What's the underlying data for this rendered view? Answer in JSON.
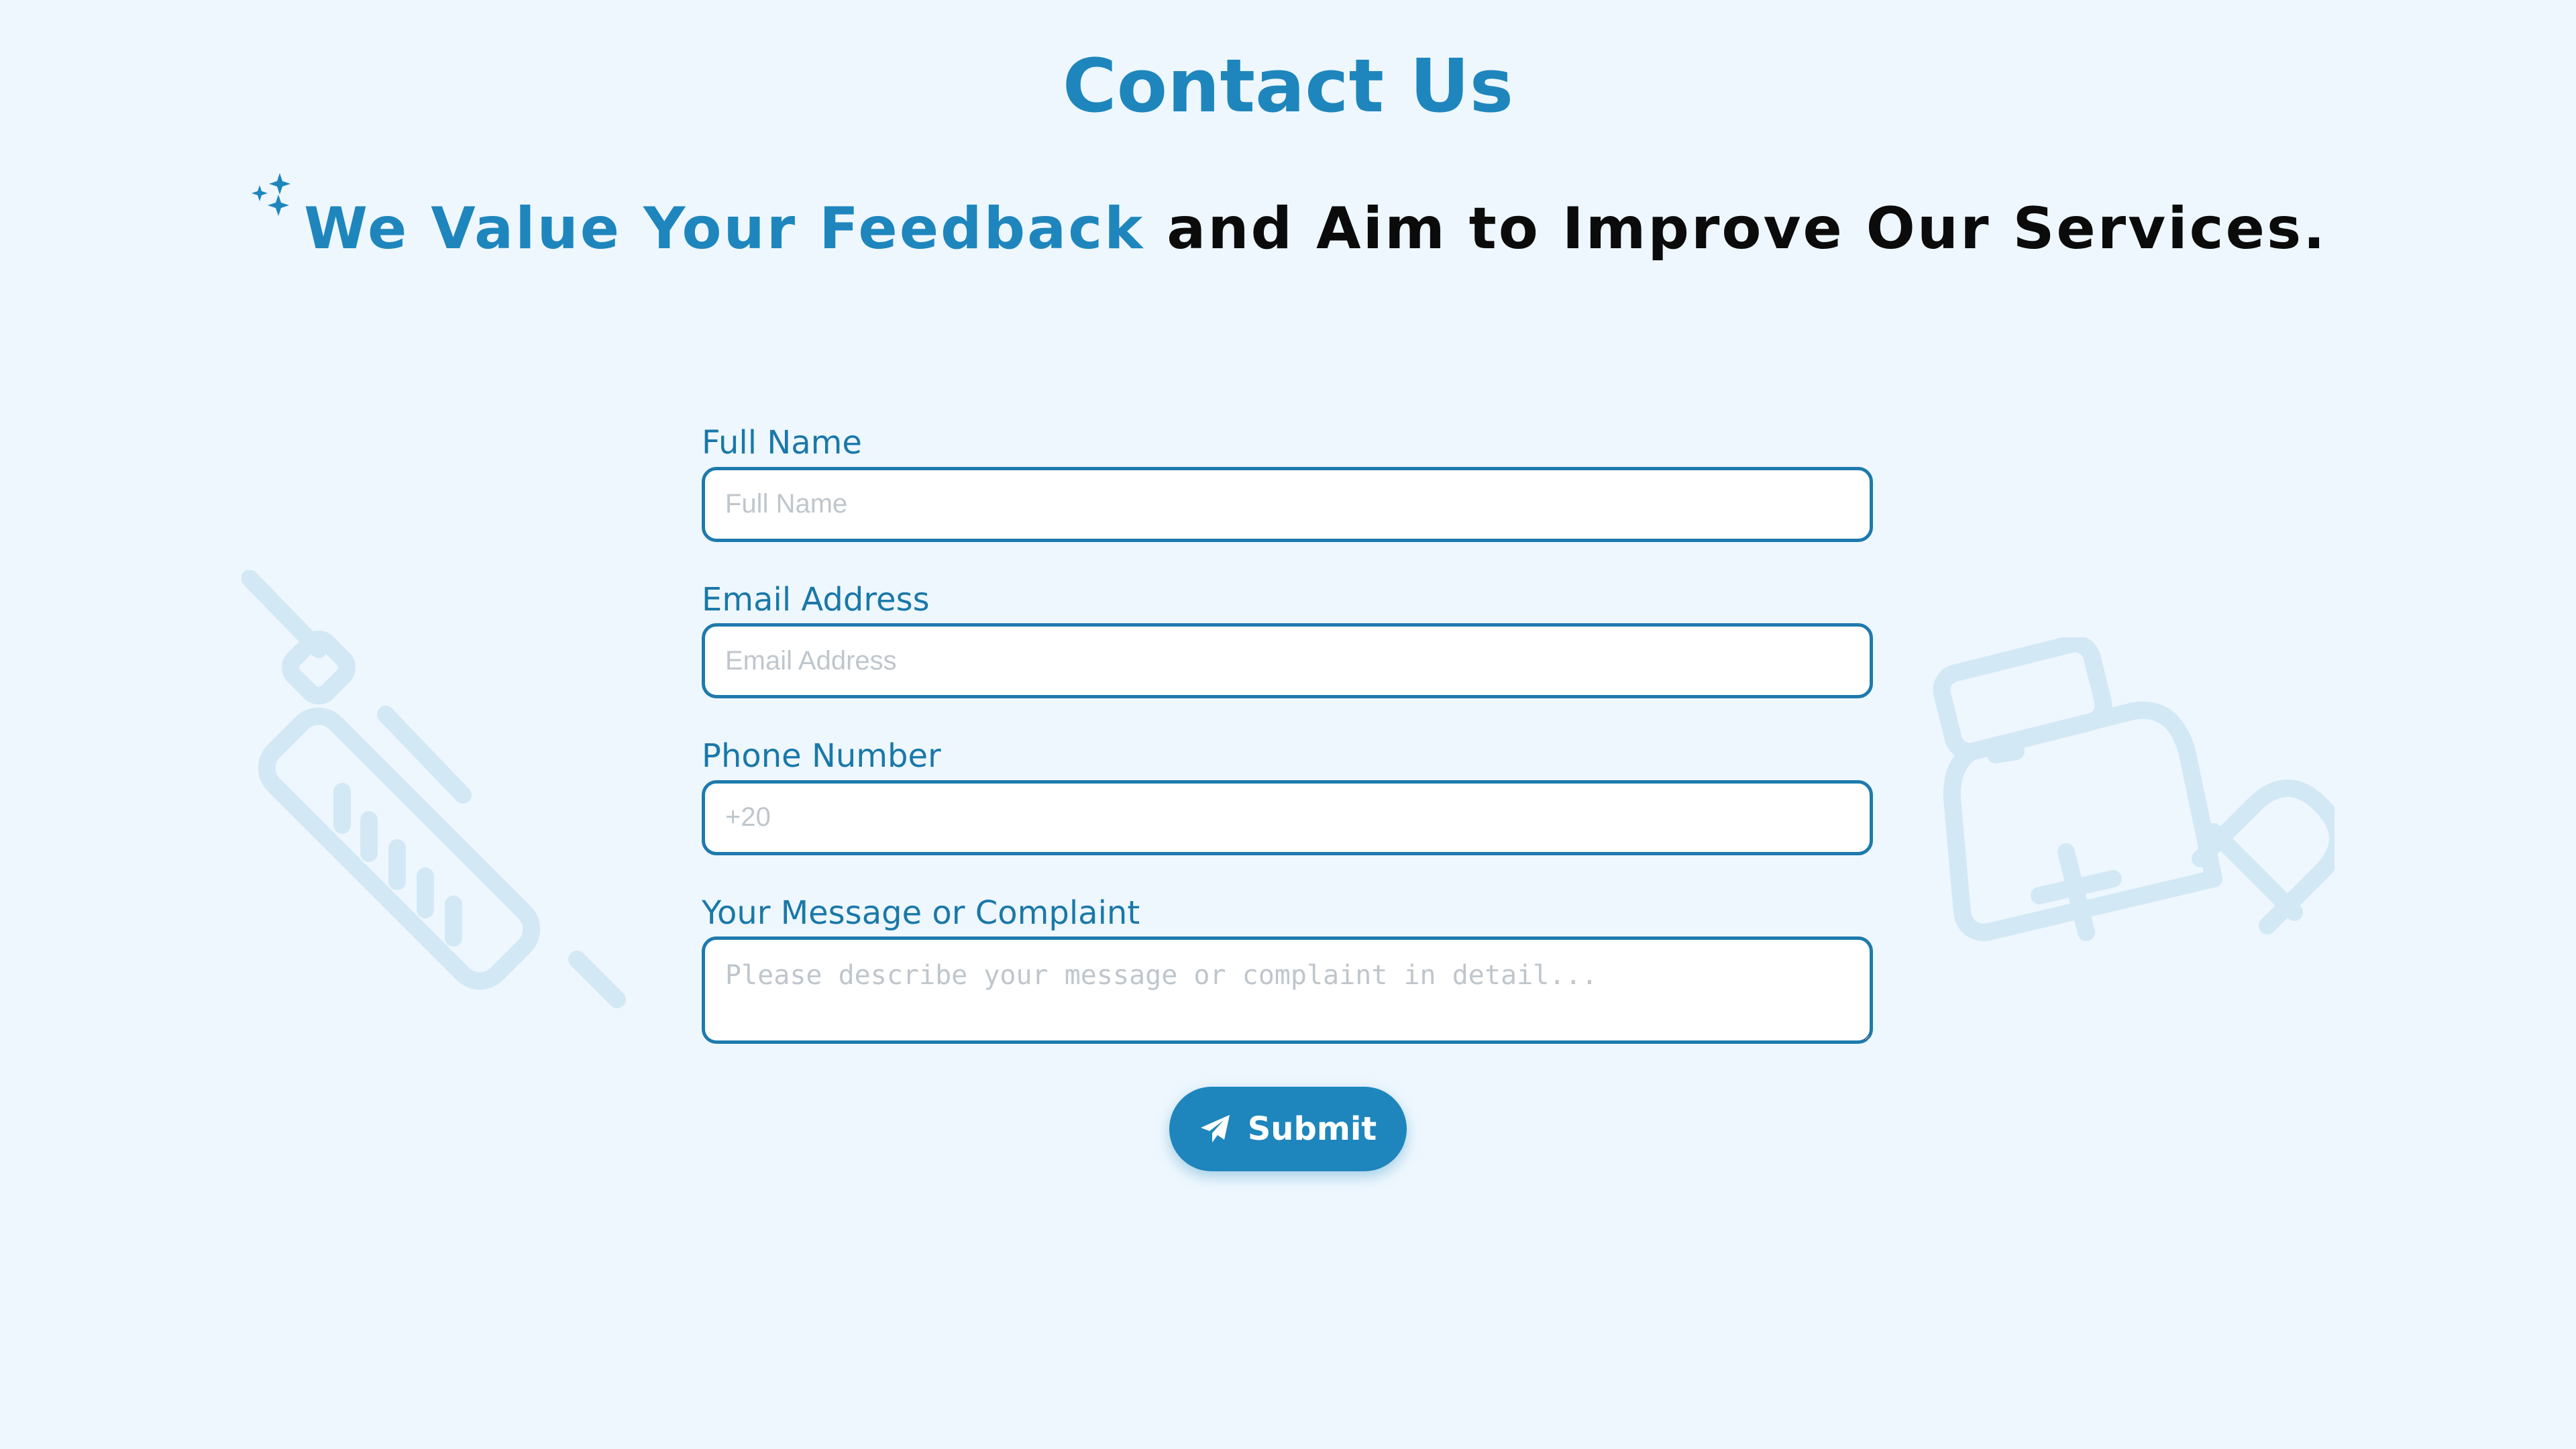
{
  "page": {
    "title": "Contact Us",
    "subtitle_highlight": "We Value Your Feedback",
    "subtitle_rest": " and Aim to Improve Our Services."
  },
  "form": {
    "full_name": {
      "label": "Full Name",
      "placeholder": "Full Name",
      "value": ""
    },
    "email": {
      "label": "Email Address",
      "placeholder": "Email Address",
      "value": ""
    },
    "phone": {
      "label": "Phone Number",
      "placeholder": "+20",
      "value": ""
    },
    "message": {
      "label": "Your Message or Complaint",
      "placeholder": "Please describe your message or complaint in detail...",
      "value": ""
    },
    "submit_label": "Submit"
  },
  "icons": {
    "title_decoration": "sparkles-icon",
    "submit": "paper-plane-icon",
    "background_left": "syringe-icon",
    "background_right": "medicine-bottle-pill-icon"
  },
  "colors": {
    "background": "#eef7fe",
    "accent": "#1e86bc",
    "input_border": "#1e7aad",
    "label": "#1a78a8",
    "decoration": "#d6eaf7"
  }
}
